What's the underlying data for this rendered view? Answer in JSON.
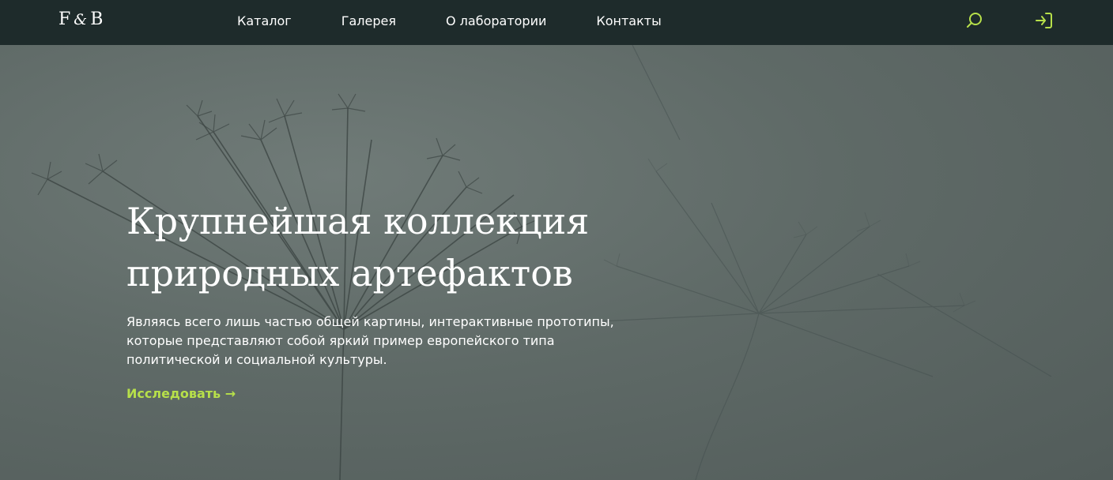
{
  "header": {
    "logo": {
      "left": "F",
      "amp": "&",
      "right": "B"
    },
    "nav": [
      {
        "label": "Каталог"
      },
      {
        "label": "Галерея"
      },
      {
        "label": "О лаборатории"
      },
      {
        "label": "Контакты"
      }
    ],
    "icons": {
      "search": "search-icon",
      "login": "login-icon"
    }
  },
  "hero": {
    "title": "Крупнейшая коллекция природных артефактов",
    "text": "Являясь всего лишь частью общей картины, интерактивные прототипы, которые представляют собой яркий пример европейского типа политической и социальной культуры.",
    "cta": "Исследовать →"
  },
  "colors": {
    "header_bg": "#1e2b2b",
    "accent": "#b7e04a",
    "hero_tint": "#5f6a67"
  }
}
